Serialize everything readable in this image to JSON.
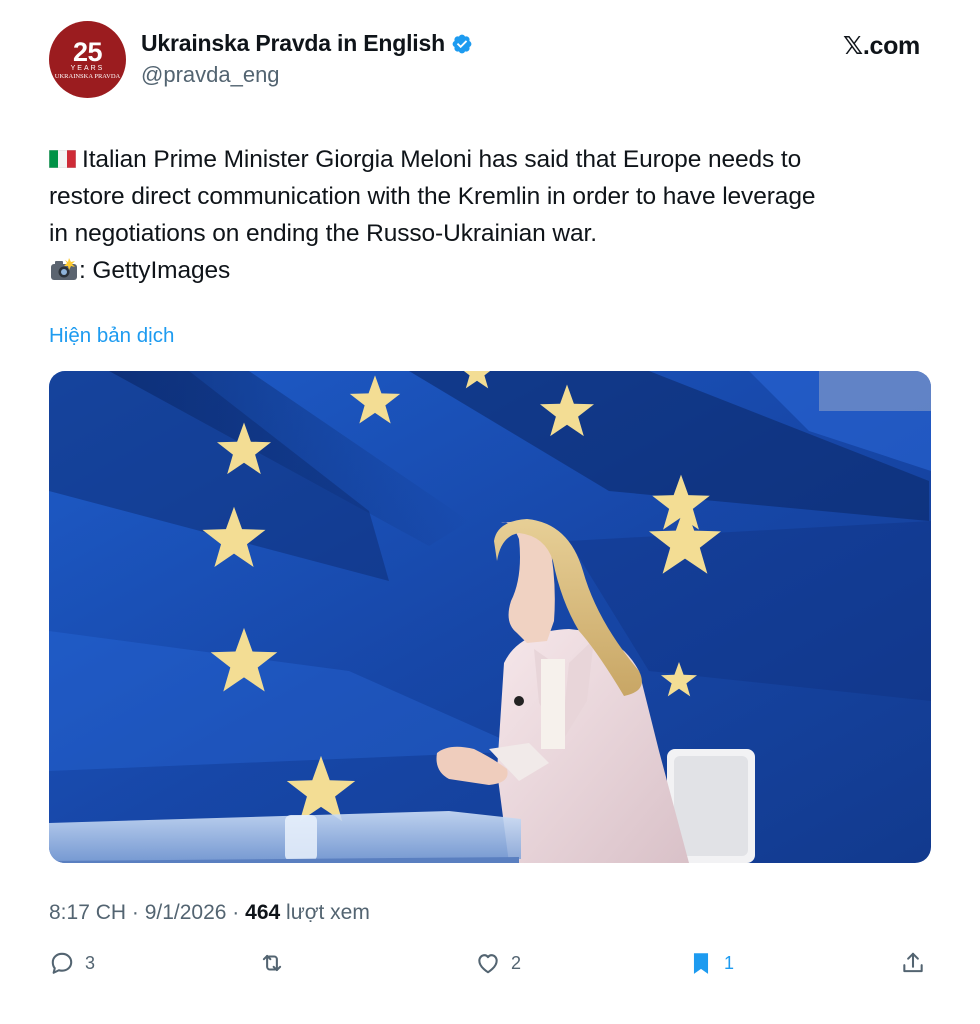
{
  "author": {
    "avatar_number": "25",
    "avatar_years": "YEARS",
    "avatar_brand": "UKRAINSKA PRAVDA",
    "name": "Ukrainska Pravda in English",
    "handle": "@pravda_eng",
    "verified_icon": "verified-badge-icon"
  },
  "site_label": "𝕏.com",
  "tweet": {
    "line1": "Italian Prime Minister Giorgia Meloni has said that Europe needs to",
    "line2": "restore direct communication with the Kremlin in order to have leverage",
    "line3": "in negotiations on ending the Russo-Ukrainian war.",
    "line4": ": GettyImages",
    "flag_icon": "italy-flag-emoji",
    "camera_icon": "camera-flash-emoji"
  },
  "translate_label": "Hiện bản dịch",
  "meta": {
    "time": "8:17 CH",
    "sep1": " · ",
    "date": "9/1/2026",
    "sep2": " · ",
    "views": "464",
    "views_label": " lượt xem"
  },
  "actions": {
    "reply_count": "3",
    "like_count": "2",
    "bookmark_count": "1"
  },
  "colors": {
    "accent": "#1d9bf0",
    "avatar_bg": "#9b1c1f",
    "muted_text": "#536471"
  }
}
